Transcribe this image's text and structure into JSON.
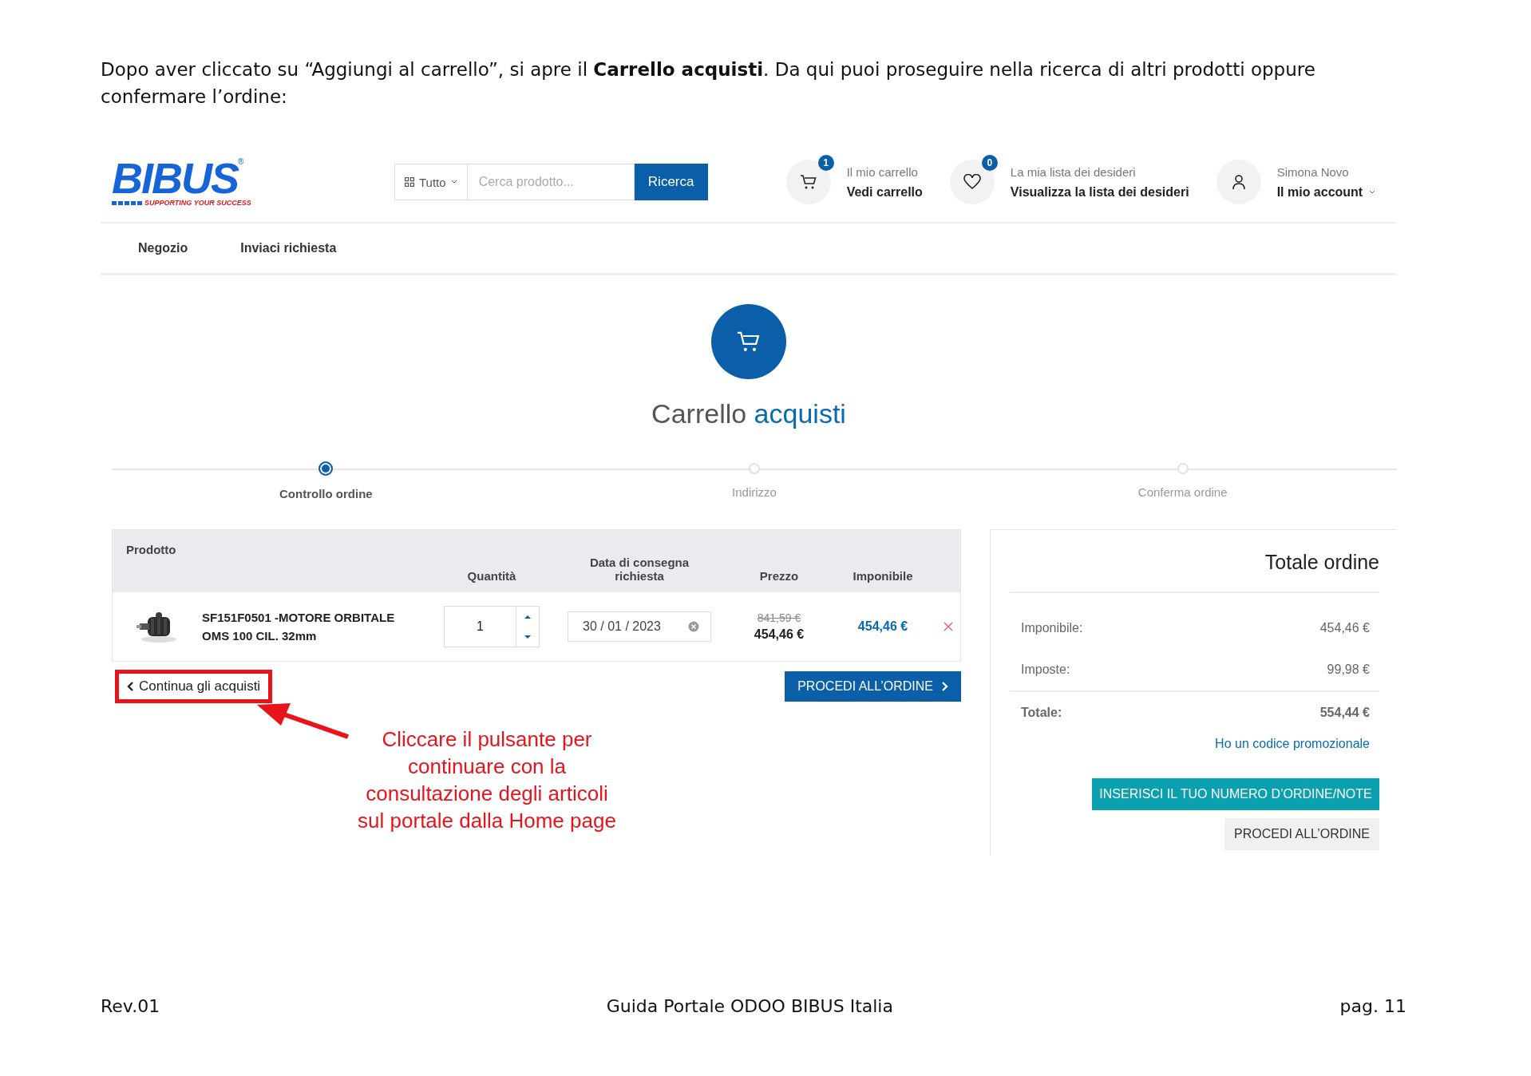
{
  "intro": "Dopo aver cliccato su “Aggiungi al carrello”, si apre il **Carrello acquisti**. Da qui puoi proseguire nella ricerca di altri prodotti oppure confermare l’ordine:",
  "header": {
    "logo": {
      "name": "BIBUS",
      "mark": "®",
      "tagline": "SUPPORTING YOUR SUCCESS"
    },
    "search": {
      "category": "Tutto",
      "placeholder": "Cerca prodotto...",
      "button": "Ricerca"
    },
    "widgets": [
      {
        "kind": "cart",
        "badge": "1",
        "caption": "Il mio carrello",
        "link": "Vedi carrello"
      },
      {
        "kind": "wishlist",
        "badge": "0",
        "caption": "La mia lista dei desideri",
        "link": "Visualizza la lista dei desideri"
      },
      {
        "kind": "account",
        "caption": "Simona Novo",
        "link": "Il mio account"
      }
    ]
  },
  "nav": [
    "Negozio",
    "Inviaci richiesta"
  ],
  "title": {
    "main": "Carrello",
    "accent": "acquisti"
  },
  "steps": [
    {
      "label": "Controllo ordine",
      "selected": true
    },
    {
      "label": "Indirizzo",
      "selected": false
    },
    {
      "label": "Conferma ordine",
      "selected": false
    }
  ],
  "table": {
    "columns": [
      "Prodotto",
      "Quantità",
      "Data di consegna richiesta",
      "Prezzo",
      "Imponibile"
    ],
    "rows": [
      {
        "kind": "picture",
        "product": "SF151F0501 -MOTORE ORBITALE OMS 100 CIL. 32mm",
        "quantity": "1",
        "date": "30 / 01 / 2023",
        "old_price": "841,59 €",
        "price": "454,46 €",
        "subtotal": "454,46 €"
      }
    ]
  },
  "continue_button": "Continua gli acquisti",
  "proceed_button": "PROCEDI ALL’ORDINE",
  "annotation": {
    "lines": [
      "Cliccare il pulsante per",
      "continuare con la",
      "consultazione degli articoli",
      "sul portale dalla Home page"
    ]
  },
  "summary": {
    "title": "Totale ordine",
    "rows": [
      {
        "kind": "line",
        "label": "Imponibile:",
        "value": "454,46 €"
      },
      {
        "kind": "line",
        "label": "Imposte:",
        "value": "99,98 €"
      },
      {
        "kind": "total",
        "label": "Totale:",
        "value": "554,44 €"
      }
    ],
    "promo_link": "Ho un codice promozionale",
    "notes_button": "INSERISCI IL TUO NUMERO D’ORDINE/NOTE",
    "order_button": "PROCEDI ALL’ORDINE"
  },
  "footer": {
    "left": "Rev.01",
    "center": "Guida Portale ODOO BIBUS Italia",
    "right": "pag. 11"
  }
}
